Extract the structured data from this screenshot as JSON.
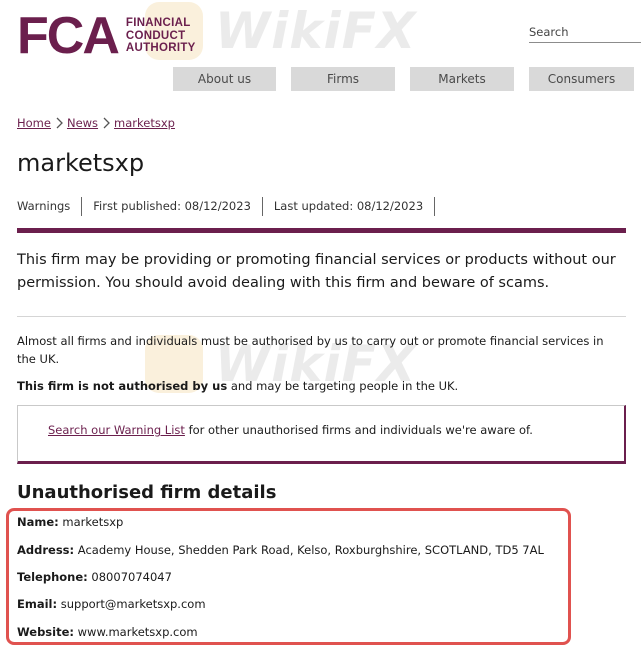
{
  "header": {
    "logo_letters": "FCA",
    "logo_words": [
      "FINANCIAL",
      "CONDUCT",
      "AUTHORITY"
    ],
    "search_placeholder": "Search",
    "nav": [
      "About us",
      "Firms",
      "Markets",
      "Consumers"
    ]
  },
  "breadcrumb": [
    "Home",
    "News",
    "marketsxp"
  ],
  "page": {
    "title": "marketsxp",
    "meta": {
      "category": "Warnings",
      "first_published": "First published: 08/12/2023",
      "last_updated": "Last updated: 08/12/2023"
    },
    "intro": "This firm may be providing or promoting financial services or products without our permission. You should avoid dealing with this firm and beware of scams.",
    "p1": "Almost all firms and individuals must be authorised by us to carry out or promote financial services in the UK.",
    "p2_bold": "This firm is not authorised by us",
    "p2_rest": " and may be targeting people in the UK.",
    "notice_link": "Search our Warning List",
    "notice_rest": " for other unauthorised firms and individuals we're aware of."
  },
  "details": {
    "title": "Unauthorised firm details",
    "rows": [
      {
        "label": "Name:",
        "value": " marketsxp"
      },
      {
        "label": "Address:",
        "value": " Academy House, Shedden Park Road, Kelso, Roxburghshire, SCOTLAND, TD5 7AL"
      },
      {
        "label": "Telephone:",
        "value": " 08007074047"
      },
      {
        "label": "Email:",
        "value": " support@marketsxp.com"
      },
      {
        "label": "Website:",
        "value": " www.marketsxp.com"
      }
    ]
  },
  "watermark": "WikiFX",
  "colors": {
    "brand": "#6b1f4d",
    "highlight": "#e0524f"
  }
}
